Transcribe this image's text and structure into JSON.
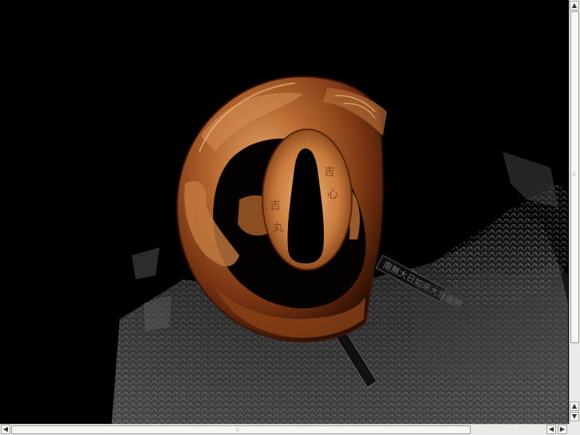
{
  "colors": {
    "background": "#000000",
    "copper_light": "#e0a36a",
    "copper_mid": "#a5582b",
    "copper_dark": "#3a1406",
    "scroll_track": "#eceae6"
  },
  "artwork": {
    "subject": "tsuba-sword-guard",
    "inscription": "吉 心 吉 丸",
    "banner_text": "南無大日如来大悲遍照"
  },
  "scrollbars": {
    "up_arrow": "▲",
    "down_arrow": "▼",
    "left_arrow": "◀",
    "right_arrow": "▶",
    "grip": ":::"
  }
}
